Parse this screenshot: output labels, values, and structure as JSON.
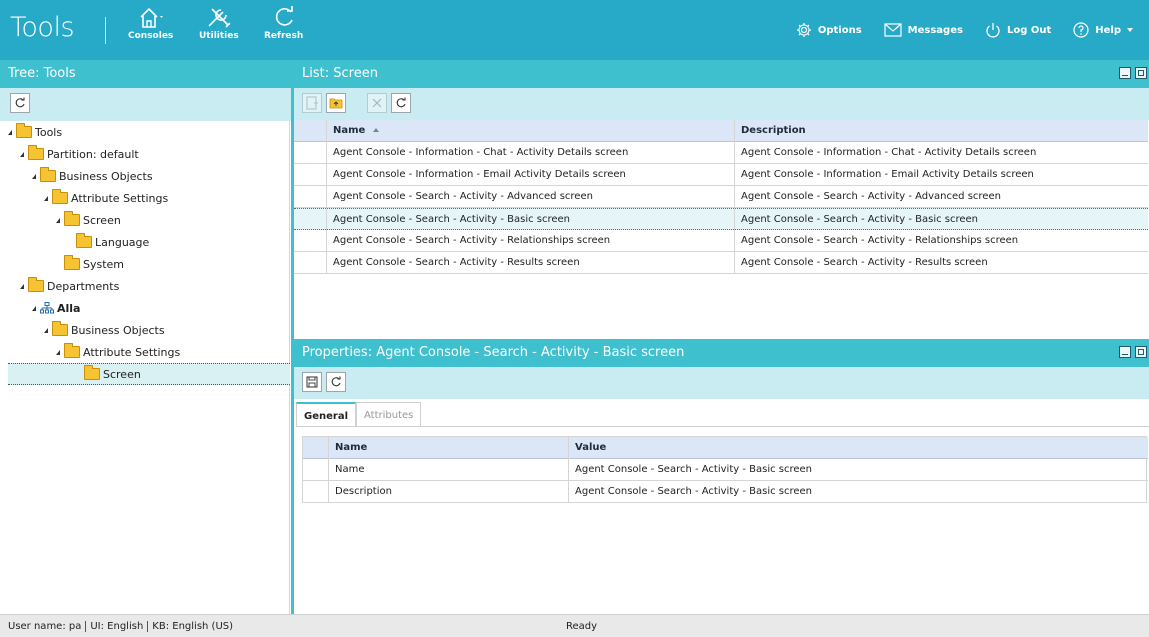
{
  "app": {
    "title": "Tools",
    "buttons": [
      {
        "label": "Consoles"
      },
      {
        "label": "Utilities"
      },
      {
        "label": "Refresh"
      }
    ],
    "menu": {
      "options": "Options",
      "messages": "Messages",
      "logout": "Log Out",
      "help": "Help"
    }
  },
  "tree_panel": {
    "title": "Tree: Tools",
    "nodes": [
      {
        "label": "Tools"
      },
      {
        "label": "Partition: default"
      },
      {
        "label": "Business Objects"
      },
      {
        "label": "Attribute Settings"
      },
      {
        "label": "Screen"
      },
      {
        "label": "Language"
      },
      {
        "label": "System"
      },
      {
        "label": "Departments"
      },
      {
        "label": "Alla"
      },
      {
        "label": "Business Objects"
      },
      {
        "label": "Attribute Settings"
      },
      {
        "label": "Screen"
      }
    ]
  },
  "list_panel": {
    "title": "List: Screen",
    "columns": [
      "Name",
      "Description"
    ],
    "rows": [
      [
        "Agent Console - Information - Chat - Activity Details screen",
        "Agent Console - Information - Chat - Activity Details screen"
      ],
      [
        "Agent Console - Information - Email Activity Details screen",
        "Agent Console - Information - Email Activity Details screen"
      ],
      [
        "Agent Console - Search - Activity - Advanced screen",
        "Agent Console - Search - Activity - Advanced screen"
      ],
      [
        "Agent Console - Search - Activity - Basic screen",
        "Agent Console - Search - Activity - Basic screen"
      ],
      [
        "Agent Console - Search - Activity - Relationships screen",
        "Agent Console - Search - Activity - Relationships screen"
      ],
      [
        "Agent Console - Search - Activity - Results screen",
        "Agent Console - Search - Activity - Results screen"
      ]
    ]
  },
  "properties_panel": {
    "title": "Properties: Agent Console - Search - Activity - Basic screen",
    "tabs": [
      "General",
      "Attributes"
    ],
    "columns": [
      "Name",
      "Value"
    ],
    "rows": [
      [
        "Name",
        "Agent Console - Search - Activity - Basic screen"
      ],
      [
        "Description",
        "Agent Console - Search - Activity - Basic screen"
      ]
    ]
  },
  "status": {
    "user": "User name: pa",
    "ui": "UI: English",
    "kb": "KB: English (US)",
    "state": "Ready"
  },
  "colors": {
    "topbar": "#27a9c8",
    "panel_header": "#3fc0ce",
    "toolbar": "#c8ecf1"
  }
}
